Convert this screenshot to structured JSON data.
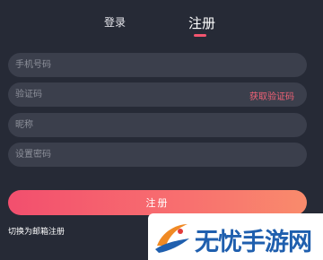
{
  "tabs": {
    "login": "登录",
    "register": "注册"
  },
  "form": {
    "phone_placeholder": "手机号码",
    "code_placeholder": "验证码",
    "get_code_label": "获取验证码",
    "nickname_placeholder": "昵称",
    "password_placeholder": "设置密码",
    "submit_label": "注册"
  },
  "switch_label": "切换为邮箱注册",
  "watermark": {
    "text": "无忧手游网",
    "icon": "swoosh-logo-icon"
  },
  "colors": {
    "background": "#262a36",
    "field": "#3b3f4c",
    "accent": "#f3556f",
    "button_gradient_start": "#f24f6e",
    "button_gradient_end": "#f98b6c",
    "watermark_text": "#1f5fae"
  }
}
